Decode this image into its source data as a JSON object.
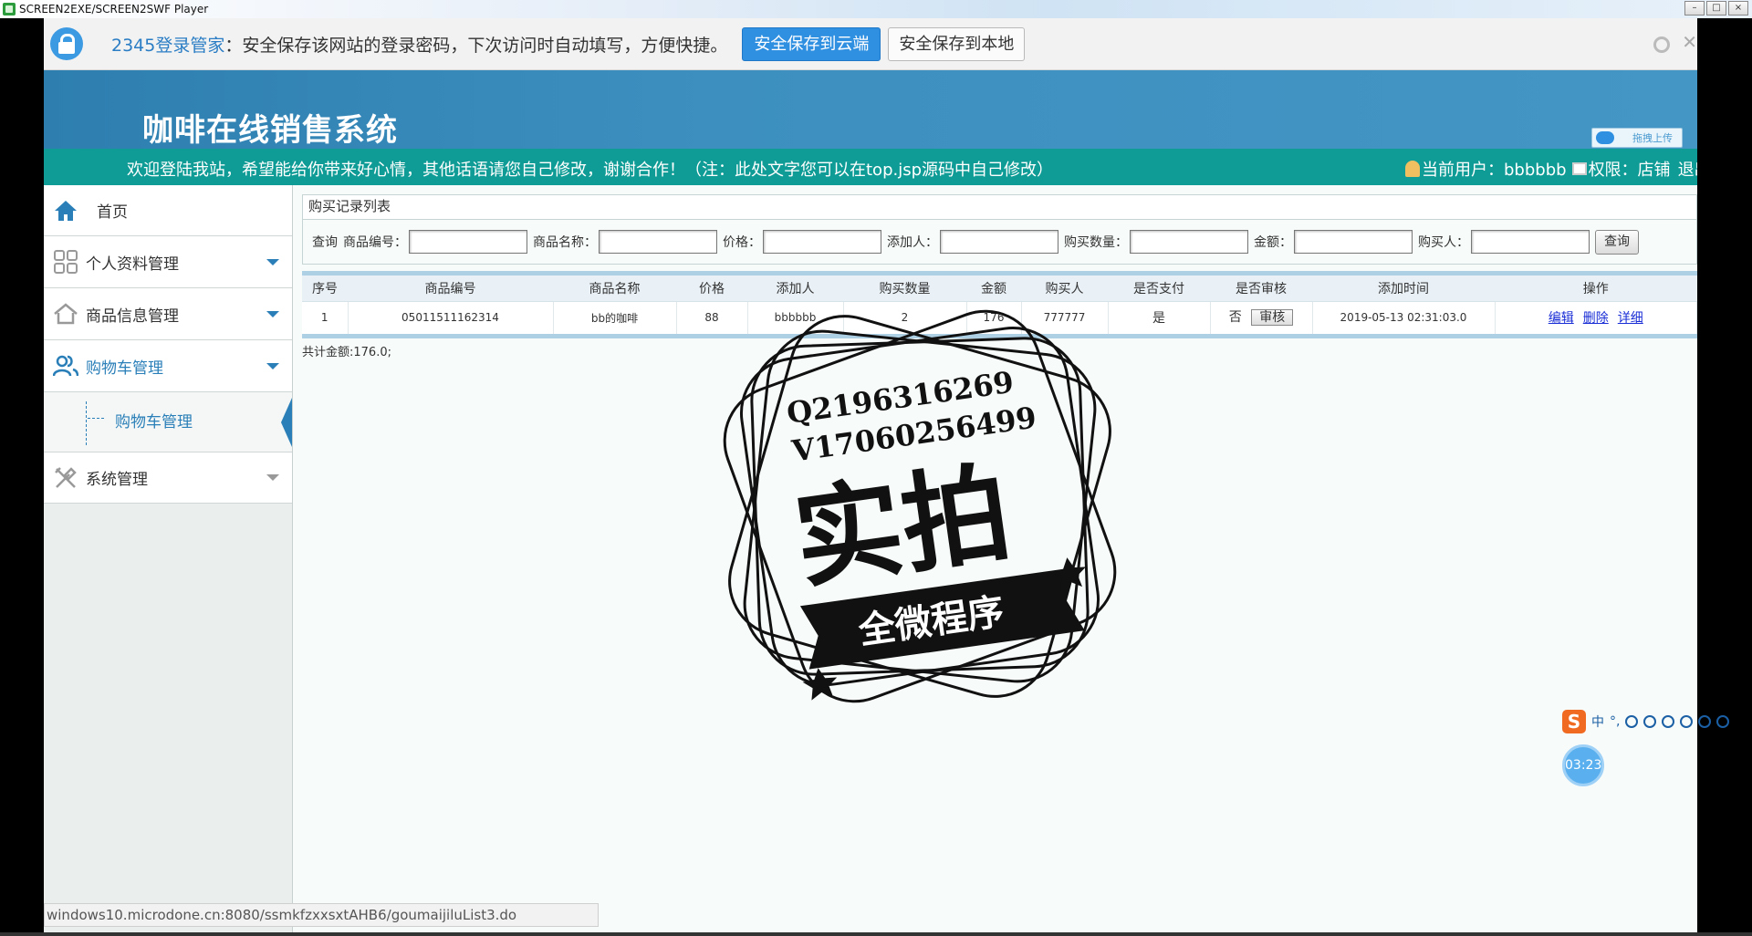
{
  "window": {
    "title": "SCREEN2EXE/SCREEN2SWF Player",
    "controls": [
      "–",
      "□",
      "×"
    ]
  },
  "password_bar": {
    "brand": "2345登录管家",
    "message": "：安全保存该网站的登录密码，下次访问时自动填写，方便快捷。",
    "save_cloud": "安全保存到云端",
    "save_local": "安全保存到本地"
  },
  "header": {
    "system_title": "咖啡在线销售系统",
    "upload_label": "拖拽上传"
  },
  "welcome": {
    "marquee": "欢迎登陆我站，希望能给你带来好心情，其他话语请您自己修改，谢谢合作！（注：此处文字您可以在top.jsp源码中自己修改）",
    "user_label": "当前用户：bbbbbb",
    "role_label": "权限：店铺",
    "logout": "退出"
  },
  "sidebar": {
    "home": "首页",
    "items": [
      {
        "label": "个人资料管理",
        "icon": "grid-icon"
      },
      {
        "label": "商品信息管理",
        "icon": "house-icon"
      },
      {
        "label": "购物车管理",
        "icon": "users-icon"
      },
      {
        "label": "系统管理",
        "icon": "tools-icon"
      }
    ],
    "sub_item": "购物车管理"
  },
  "panel": {
    "title": "购买记录列表"
  },
  "search": {
    "query_label": "查询",
    "fields": [
      {
        "label": "商品编号：",
        "value": ""
      },
      {
        "label": "商品名称：",
        "value": ""
      },
      {
        "label": "价格：",
        "value": ""
      },
      {
        "label": "添加人：",
        "value": ""
      },
      {
        "label": "购买数量：",
        "value": ""
      },
      {
        "label": "金额：",
        "value": ""
      },
      {
        "label": "购买人：",
        "value": ""
      }
    ],
    "button": "查询"
  },
  "table": {
    "headers": [
      "序号",
      "商品编号",
      "商品名称",
      "价格",
      "添加人",
      "购买数量",
      "金额",
      "购买人",
      "是否支付",
      "是否审核",
      "添加时间",
      "操作"
    ],
    "rows": [
      {
        "index": "1",
        "product_no": "05011511162314",
        "product_name": "bb的咖啡",
        "price": "88",
        "added_by": "bbbbbb",
        "quantity": "2",
        "amount": "176",
        "buyer": "777777",
        "paid": "是",
        "audited": "否",
        "audit_button": "审核",
        "added_time": "2019-05-13 02:31:03.0",
        "actions": [
          "编辑",
          "删除",
          "详细"
        ]
      }
    ]
  },
  "total": "共计金额:176.0;",
  "watermark": {
    "qq": "Q2196316269",
    "wechat": "V17060256499",
    "big_text": "实拍",
    "ribbon": "全微程序"
  },
  "ime": {
    "lang": "中",
    "punct": "°,"
  },
  "timer": "03:23",
  "status_url": "windows10.microdone.cn:8080/ssmkfzxxsxtAHB6/goumaijiluList3.do"
}
